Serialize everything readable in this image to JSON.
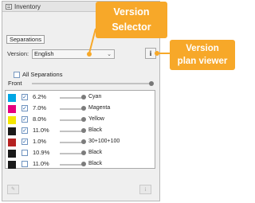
{
  "window": {
    "title": "Inventory",
    "close_glyph": "✕"
  },
  "tabs": [
    "Separations"
  ],
  "version": {
    "label": "Version:",
    "value": "English",
    "chevron": "⌄",
    "info": "i"
  },
  "all_separations": {
    "label": "All Separations",
    "checked": false
  },
  "front": {
    "label": "Front"
  },
  "separations": [
    {
      "color": "#00a6e4",
      "checked": true,
      "percent": "6.2%",
      "name": "Cyan"
    },
    {
      "color": "#e6007e",
      "checked": true,
      "percent": "7.0%",
      "name": "Magenta"
    },
    {
      "color": "#f5e600",
      "checked": true,
      "percent": "8.0%",
      "name": "Yellow"
    },
    {
      "color": "#1a1a1a",
      "checked": true,
      "percent": "11.0%",
      "name": "Black"
    },
    {
      "color": "#b52222",
      "checked": true,
      "percent": "1.0%",
      "name": "30+100+100"
    },
    {
      "color": "#1a1a1a",
      "checked": false,
      "percent": "10.9%",
      "name": "Black"
    },
    {
      "color": "#1a1a1a",
      "checked": false,
      "percent": "11.0%",
      "name": "Black"
    }
  ],
  "bottom": {
    "left_glyph": "✎",
    "right_glyph": "i"
  },
  "callouts": {
    "version_selector": {
      "line1": "Version",
      "line2": "Selector"
    },
    "version_plan_viewer": {
      "line1": "Version",
      "line2": "plan viewer"
    }
  },
  "colors": {
    "callout": "#f7a829",
    "check": "#1f5fa8"
  }
}
